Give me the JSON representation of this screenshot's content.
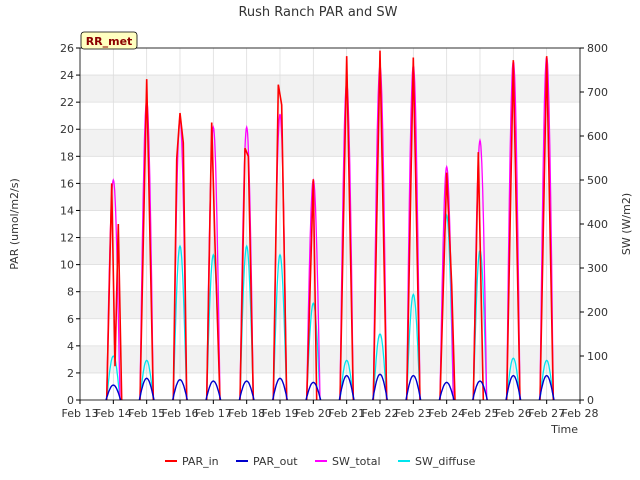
{
  "chart_data": {
    "type": "line",
    "title": "Rush Ranch PAR and SW",
    "badge": "RR_met",
    "xlabel": "Time",
    "ylabel_left": "PAR (umol/m2/s)",
    "ylabel_right": "SW (W/m2)",
    "x_ticks": [
      "Feb 13",
      "Feb 14",
      "Feb 15",
      "Feb 16",
      "Feb 17",
      "Feb 18",
      "Feb 19",
      "Feb 20",
      "Feb 21",
      "Feb 22",
      "Feb 23",
      "Feb 24",
      "Feb 25",
      "Feb 26",
      "Feb 27",
      "Feb 28"
    ],
    "xlim": [
      13,
      28
    ],
    "ylim_left": [
      0,
      26
    ],
    "ylim_right": [
      0,
      800
    ],
    "y_ticks_left": [
      0,
      2,
      4,
      6,
      8,
      10,
      12,
      14,
      16,
      18,
      20,
      22,
      24,
      26
    ],
    "y_ticks_right": [
      0,
      100,
      200,
      300,
      400,
      500,
      600,
      700,
      800
    ],
    "grid": true,
    "legend_position": "bottom",
    "colors": {
      "PAR_in": "#ff0000",
      "PAR_out": "#0000cc",
      "SW_total": "#ff00ff",
      "SW_diffuse": "#00e5ee",
      "band": "#f2f2f2"
    },
    "series": [
      {
        "name": "PAR_in",
        "axis": "left",
        "days": [
          {
            "date": "Feb 14",
            "peaks": [
              [
                13.8,
                0
              ],
              [
                13.95,
                16
              ],
              [
                14.05,
                2.5
              ],
              [
                14.15,
                13
              ],
              [
                14.25,
                0
              ]
            ]
          },
          {
            "date": "Feb 15",
            "peaks": [
              [
                14.8,
                0
              ],
              [
                15.0,
                23.7
              ],
              [
                15.2,
                0
              ]
            ]
          },
          {
            "date": "Feb 16",
            "peaks": [
              [
                15.8,
                0
              ],
              [
                15.9,
                17.8
              ],
              [
                16.0,
                21.2
              ],
              [
                16.1,
                19
              ],
              [
                16.2,
                0
              ]
            ]
          },
          {
            "date": "Feb 17",
            "peaks": [
              [
                16.8,
                0
              ],
              [
                16.95,
                20.5
              ],
              [
                17.05,
                11.5
              ],
              [
                17.2,
                0
              ]
            ]
          },
          {
            "date": "Feb 18",
            "peaks": [
              [
                17.8,
                0
              ],
              [
                17.95,
                18.6
              ],
              [
                18.05,
                18
              ],
              [
                18.2,
                0
              ]
            ]
          },
          {
            "date": "Feb 19",
            "peaks": [
              [
                18.8,
                0
              ],
              [
                18.95,
                23.3
              ],
              [
                19.05,
                21.8
              ],
              [
                19.2,
                0
              ]
            ]
          },
          {
            "date": "Feb 20",
            "peaks": [
              [
                19.8,
                0
              ],
              [
                19.9,
                8
              ],
              [
                20.0,
                16.3
              ],
              [
                20.1,
                0
              ]
            ]
          },
          {
            "date": "Feb 21",
            "peaks": [
              [
                20.8,
                0
              ],
              [
                21.0,
                25.4
              ],
              [
                21.2,
                0
              ]
            ]
          },
          {
            "date": "Feb 22",
            "peaks": [
              [
                21.8,
                0
              ],
              [
                22.0,
                25.8
              ],
              [
                22.2,
                0
              ]
            ]
          },
          {
            "date": "Feb 23",
            "peaks": [
              [
                22.8,
                0
              ],
              [
                23.0,
                25.3
              ],
              [
                23.2,
                0
              ]
            ]
          },
          {
            "date": "Feb 24",
            "peaks": [
              [
                23.8,
                0
              ],
              [
                24.0,
                16.8
              ],
              [
                24.15,
                8.5
              ],
              [
                24.25,
                0
              ]
            ]
          },
          {
            "date": "Feb 25",
            "peaks": [
              [
                24.8,
                0
              ],
              [
                24.95,
                18.3
              ],
              [
                25.1,
                0
              ]
            ]
          },
          {
            "date": "Feb 26",
            "peaks": [
              [
                25.8,
                0
              ],
              [
                26.0,
                25.1
              ],
              [
                26.2,
                0
              ]
            ]
          },
          {
            "date": "Feb 27",
            "peaks": [
              [
                26.8,
                0
              ],
              [
                27.0,
                25.4
              ],
              [
                27.2,
                0
              ]
            ]
          }
        ]
      },
      {
        "name": "PAR_out",
        "axis": "left",
        "daily_peak": [
          1.1,
          1.6,
          1.5,
          1.4,
          1.4,
          1.6,
          1.3,
          1.8,
          1.9,
          1.8,
          1.3,
          1.4,
          1.8,
          1.8
        ]
      },
      {
        "name": "SW_total",
        "axis": "right",
        "daily_peak": [
          500,
          680,
          640,
          620,
          620,
          650,
          500,
          720,
          760,
          760,
          530,
          590,
          770,
          780
        ]
      },
      {
        "name": "SW_diffuse",
        "axis": "right",
        "daily_peak": [
          100,
          90,
          350,
          330,
          350,
          330,
          220,
          90,
          150,
          240,
          420,
          340,
          95,
          90
        ]
      }
    ]
  }
}
